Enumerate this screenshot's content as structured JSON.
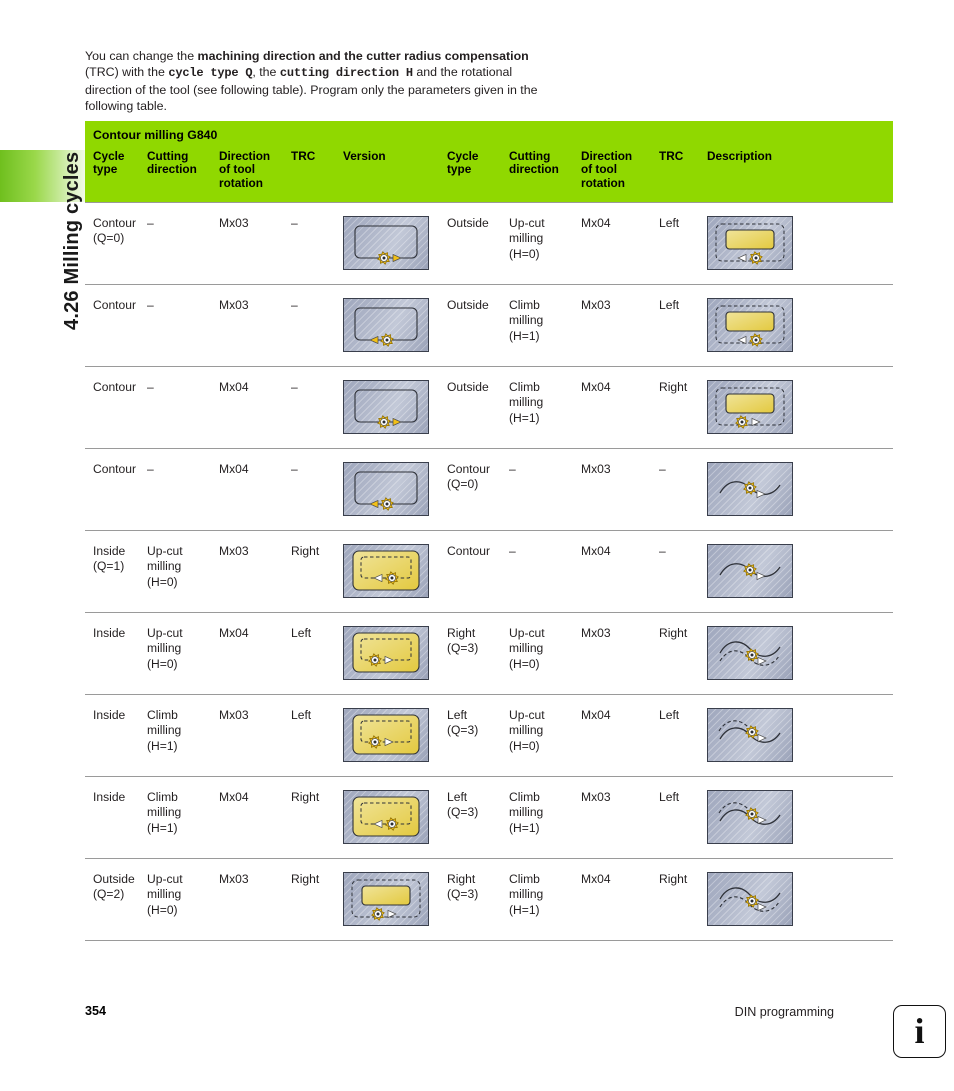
{
  "sidebar": {
    "chapter_label": "4.26 Milling cycles"
  },
  "intro": {
    "t1": "You can change the ",
    "b1": "machining direction and the cutter radius compensation",
    "t2": " (TRC) with the ",
    "code1": "cycle type Q",
    "t3": ", the ",
    "code2": "cutting direction H",
    "t4": " and the rotational direction of the tool (see following table). Program only the parameters given in the following table."
  },
  "table": {
    "title": "Contour milling G840",
    "headers": [
      "Cycle\ntype",
      "Cutting\ndirection",
      "Direction\nof tool\nrotation",
      "TRC",
      "Version",
      "Cycle\ntype",
      "Cutting\ndirection",
      "Direction\nof tool\nrotation",
      "TRC",
      "Description"
    ],
    "headers_flat": [
      [
        "Cycle",
        "type"
      ],
      [
        "Cutting",
        "direction"
      ],
      [
        "Direction",
        "of tool",
        "rotation"
      ],
      [
        "TRC"
      ],
      [
        "Version"
      ],
      [
        "Cycle",
        "type"
      ],
      [
        "Cutting",
        "direction"
      ],
      [
        "Direction",
        "of tool",
        "rotation"
      ],
      [
        "TRC"
      ],
      [
        "Description"
      ]
    ],
    "rows": [
      {
        "left": {
          "cycle_type": [
            "Contour",
            "(Q=0)"
          ],
          "cutting_direction": [
            "–"
          ],
          "tool_rotation": [
            "Mx03"
          ],
          "trc": [
            "–"
          ],
          "diagram": "contour-cw-right-arrow"
        },
        "right": {
          "cycle_type": [
            "Outside"
          ],
          "cutting_direction": [
            "Up-cut",
            "milling",
            "(H=0)"
          ],
          "tool_rotation": [
            "Mx04"
          ],
          "trc": [
            "Left"
          ],
          "diagram": "outside-pocket-left-arrow-ccw"
        }
      },
      {
        "left": {
          "cycle_type": [
            "Contour"
          ],
          "cutting_direction": [
            "–"
          ],
          "tool_rotation": [
            "Mx03"
          ],
          "trc": [
            "–"
          ],
          "diagram": "contour-ccw-left-arrow"
        },
        "right": {
          "cycle_type": [
            "Outside"
          ],
          "cutting_direction": [
            "Climb",
            "milling",
            "(H=1)"
          ],
          "tool_rotation": [
            "Mx03"
          ],
          "trc": [
            "Left"
          ],
          "diagram": "outside-pocket-left-arrow-cw"
        }
      },
      {
        "left": {
          "cycle_type": [
            "Contour"
          ],
          "cutting_direction": [
            "–"
          ],
          "tool_rotation": [
            "Mx04"
          ],
          "trc": [
            "–"
          ],
          "diagram": "contour-cw-right-arrow-2"
        },
        "right": {
          "cycle_type": [
            "Outside"
          ],
          "cutting_direction": [
            "Climb",
            "milling",
            "(H=1)"
          ],
          "tool_rotation": [
            "Mx04"
          ],
          "trc": [
            "Right"
          ],
          "diagram": "outside-pocket-right-arrow-cw"
        }
      },
      {
        "left": {
          "cycle_type": [
            "Contour"
          ],
          "cutting_direction": [
            "–"
          ],
          "tool_rotation": [
            "Mx04"
          ],
          "trc": [
            "–"
          ],
          "diagram": "contour-ccw-left-arrow-2"
        },
        "right": {
          "cycle_type": [
            "Contour",
            "(Q=0)"
          ],
          "cutting_direction": [
            "–"
          ],
          "tool_rotation": [
            "Mx03"
          ],
          "trc": [
            "–"
          ],
          "diagram": "open-curve-right"
        }
      },
      {
        "left": {
          "cycle_type": [
            "Inside",
            "(Q=1)"
          ],
          "cutting_direction": [
            "Up-cut",
            "milling",
            "(H=0)"
          ],
          "tool_rotation": [
            "Mx03"
          ],
          "trc": [
            "Right"
          ],
          "diagram": "inside-pocket-left-arrow"
        },
        "right": {
          "cycle_type": [
            "Contour"
          ],
          "cutting_direction": [
            "–"
          ],
          "tool_rotation": [
            "Mx04"
          ],
          "trc": [
            "–"
          ],
          "diagram": "open-curve-right-2"
        }
      },
      {
        "left": {
          "cycle_type": [
            "Inside"
          ],
          "cutting_direction": [
            "Up-cut",
            "milling",
            "(H=0)"
          ],
          "tool_rotation": [
            "Mx04"
          ],
          "trc": [
            "Left"
          ],
          "diagram": "inside-pocket-right-arrow"
        },
        "right": {
          "cycle_type": [
            "Right",
            "(Q=3)"
          ],
          "cutting_direction": [
            "Up-cut",
            "milling",
            "(H=0)"
          ],
          "tool_rotation": [
            "Mx03"
          ],
          "trc": [
            "Right"
          ],
          "diagram": "curve-offset-right"
        }
      },
      {
        "left": {
          "cycle_type": [
            "Inside"
          ],
          "cutting_direction": [
            "Climb",
            "milling",
            "(H=1)"
          ],
          "tool_rotation": [
            "Mx03"
          ],
          "trc": [
            "Left"
          ],
          "diagram": "inside-pocket-right-arrow-2"
        },
        "right": {
          "cycle_type": [
            "Left",
            "(Q=3)"
          ],
          "cutting_direction": [
            "Up-cut",
            "milling",
            "(H=0)"
          ],
          "tool_rotation": [
            "Mx04"
          ],
          "trc": [
            "Left"
          ],
          "diagram": "curve-offset-left"
        }
      },
      {
        "left": {
          "cycle_type": [
            "Inside"
          ],
          "cutting_direction": [
            "Climb",
            "milling",
            "(H=1)"
          ],
          "tool_rotation": [
            "Mx04"
          ],
          "trc": [
            "Right"
          ],
          "diagram": "inside-pocket-left-arrow-2"
        },
        "right": {
          "cycle_type": [
            "Left",
            "(Q=3)"
          ],
          "cutting_direction": [
            "Climb",
            "milling",
            "(H=1)"
          ],
          "tool_rotation": [
            "Mx03"
          ],
          "trc": [
            "Left"
          ],
          "diagram": "curve-offset-left-2"
        }
      },
      {
        "left": {
          "cycle_type": [
            "Outside",
            "(Q=2)"
          ],
          "cutting_direction": [
            "Up-cut",
            "milling",
            "(H=0)"
          ],
          "tool_rotation": [
            "Mx03"
          ],
          "trc": [
            "Right"
          ],
          "diagram": "outside-pocket-right-arrow-ccw"
        },
        "right": {
          "cycle_type": [
            "Right",
            "(Q=3)"
          ],
          "cutting_direction": [
            "Climb",
            "milling",
            "(H=1)"
          ],
          "tool_rotation": [
            "Mx04"
          ],
          "trc": [
            "Right"
          ],
          "diagram": "curve-offset-right-2"
        }
      }
    ]
  },
  "footer": {
    "page_number": "354",
    "section": "DIN programming",
    "info_glyph": "i"
  },
  "colors": {
    "accent_green": "#90d800",
    "sidebar_green": "#6fbf1e",
    "rule": "#9a9a9a",
    "diagram_yellow": "#ecd66a",
    "tool_yellow": "#f2c017"
  }
}
